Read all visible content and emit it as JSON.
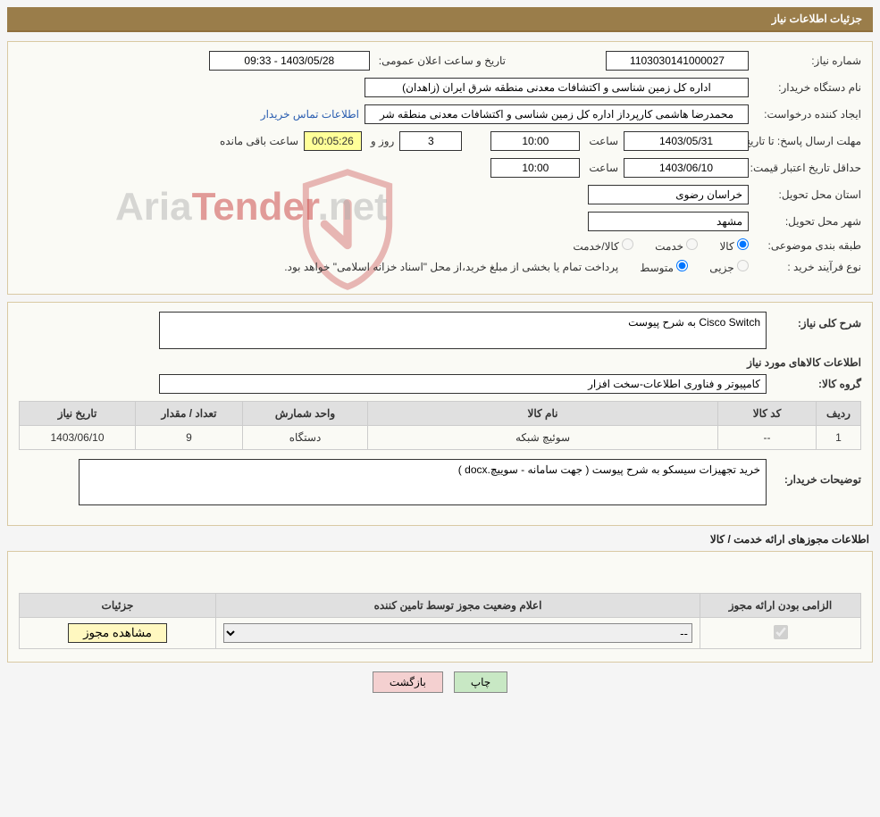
{
  "header": {
    "title": "جزئیات اطلاعات نیاز"
  },
  "fields": {
    "need_no_label": "شماره نیاز:",
    "need_no": "1103030141000027",
    "announce_dt_label": "تاریخ و ساعت اعلان عمومی:",
    "announce_dt": "1403/05/28 - 09:33",
    "buyer_org_label": "نام دستگاه خریدار:",
    "buyer_org": "اداره کل زمین شناسی و اکتشافات معدنی منطقه شرق ایران (زاهدان)",
    "requester_label": "ایجاد کننده درخواست:",
    "requester": "محمدرضا هاشمی کارپرداز اداره کل زمین شناسی و اکتشافات معدنی منطقه شر",
    "buyer_contact_link": "اطلاعات تماس خریدار",
    "deadline_label": "مهلت ارسال پاسخ: تا تاریخ:",
    "deadline_date": "1403/05/31",
    "time_label": "ساعت",
    "deadline_time": "10:00",
    "days_value": "3",
    "days_word": "روز و",
    "countdown": "00:05:26",
    "remaining_label": "ساعت باقی مانده",
    "price_valid_label": "حداقل تاریخ اعتبار قیمت: تا تاریخ:",
    "price_valid_date": "1403/06/10",
    "price_valid_time": "10:00",
    "province_label": "استان محل تحویل:",
    "province": "خراسان رضوی",
    "city_label": "شهر محل تحویل:",
    "city": "مشهد",
    "category_label": "طبقه بندی موضوعی:",
    "cat_goods": "کالا",
    "cat_service": "خدمت",
    "cat_goods_service": "کالا/خدمت",
    "purchase_type_label": "نوع فرآیند خرید :",
    "pt_small": "جزیی",
    "pt_medium": "متوسط",
    "payment_note": "پرداخت تمام یا بخشی از مبلغ خرید،از محل \"اسناد خزانه اسلامی\" خواهد بود."
  },
  "need": {
    "summary_label": "شرح کلی نیاز:",
    "summary": "Cisco Switch به شرح پیوست",
    "goods_info_heading": "اطلاعات کالاهای مورد نیاز",
    "group_label": "گروه کالا:",
    "group": "کامپیوتر و فناوری اطلاعات-سخت افزار",
    "buyer_notes_label": "توضیحات خریدار:",
    "buyer_notes": "خرید تجهیزات سیسکو به شرح پیوست ( جهت سامانه - سوییچ.docx )"
  },
  "table": {
    "headers": {
      "row": "ردیف",
      "code": "کد کالا",
      "name": "نام کالا",
      "unit": "واحد شمارش",
      "qty": "تعداد / مقدار",
      "need_date": "تاریخ نیاز"
    },
    "rows": [
      {
        "row": "1",
        "code": "--",
        "name": "سوئیچ شبکه",
        "unit": "دستگاه",
        "qty": "9",
        "need_date": "1403/06/10"
      }
    ]
  },
  "licenses": {
    "heading": "اطلاعات مجوزهای ارائه خدمت / کالا",
    "headers": {
      "mandatory": "الزامی بودن ارائه مجوز",
      "status": "اعلام وضعیت مجوز توسط تامین کننده",
      "details": "جزئیات"
    },
    "status_selected": "--",
    "view_btn": "مشاهده مجوز"
  },
  "buttons": {
    "print": "چاپ",
    "back": "بازگشت"
  },
  "watermark": {
    "text_a": "Aria",
    "text_b": "Tender",
    "text_c": ".net"
  }
}
